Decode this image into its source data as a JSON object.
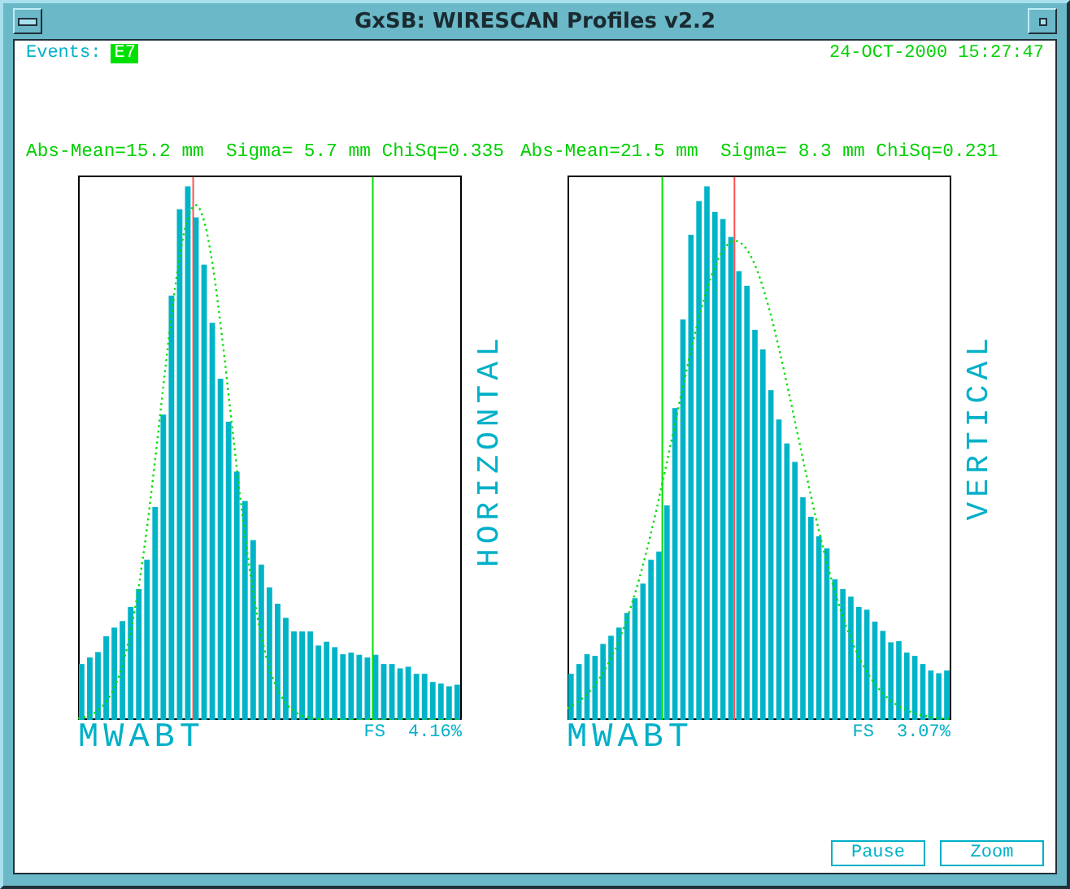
{
  "window": {
    "title": "GxSB: WIRESCAN Profiles v2.2"
  },
  "header": {
    "events_label": "Events:",
    "events_value": "E7",
    "timestamp": "24-OCT-2000 15:27:47"
  },
  "panels": [
    {
      "stats": "Abs-Mean=15.2 mm  Sigma= 5.7 mm ChiSq=0.335",
      "plane": "HORIZONTAL",
      "axis_label": "MWABT",
      "fs_label": "FS",
      "fs_value": "4.16%"
    },
    {
      "stats": "Abs-Mean=21.5 mm  Sigma= 8.3 mm ChiSq=0.231",
      "plane": "VERTICAL",
      "axis_label": "MWABT",
      "fs_label": "FS",
      "fs_value": "3.07%"
    }
  ],
  "buttons": [
    "Pause",
    "Zoom"
  ]
}
